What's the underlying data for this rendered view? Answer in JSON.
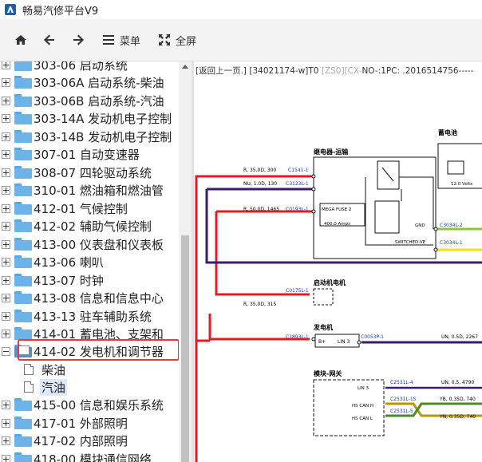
{
  "window": {
    "title": "畅易汽修平台V9"
  },
  "toolbar": {
    "menu_label": "菜单",
    "fullscreen_label": "全屏"
  },
  "tree": {
    "items": [
      {
        "label": "303-06 启动系统"
      },
      {
        "label": "303-06A 启动系统-柴油"
      },
      {
        "label": "303-06B 启动系统-汽油"
      },
      {
        "label": "303-14A 发动机电子控制"
      },
      {
        "label": "303-14B 发动机电子控制"
      },
      {
        "label": "307-01 自动变速器"
      },
      {
        "label": "308-07 四轮驱动系统"
      },
      {
        "label": "310-01 燃油箱和燃油管"
      },
      {
        "label": "412-01 气候控制"
      },
      {
        "label": "412-02 辅助气候控制"
      },
      {
        "label": "413-00 仪表盘和仪表板"
      },
      {
        "label": "413-06 喇叭"
      },
      {
        "label": "413-07 时钟"
      },
      {
        "label": "413-08 信息和信息中心"
      },
      {
        "label": "413-13 驻车辅助系统"
      },
      {
        "label": "414-01 蓄电池、支架和"
      },
      {
        "label": "414-02 发电机和调节器"
      },
      {
        "label": "415-00 信息和娱乐系统"
      },
      {
        "label": "417-01 外部照明"
      },
      {
        "label": "417-02 内部照明"
      },
      {
        "label": "418-00 模块通信网络"
      }
    ],
    "children": [
      {
        "label": "柴油"
      },
      {
        "label": "汽油"
      }
    ]
  },
  "diagram": {
    "header_main": "[返回上一页.]",
    "header_code": "[34021174-w]T0",
    "header_dim": "[ZS0][CX-",
    "header_tail": "NO-:1PC: .2016514756-----",
    "labels": {
      "battery": "蓄电池",
      "relay": "继电器-运输",
      "starter": "启动机电机",
      "generator": "发电机",
      "gateway": "模块-网关",
      "fuse": "MEGA FUSE 2",
      "fuse_amps": "400.0 Amps",
      "volts": "12.0 Volts",
      "gnd": "GND",
      "switched": "SWITCHED-VE",
      "lin3": "LIN 3",
      "lin3b": "LIN 3",
      "hs_can_h": "HS CAN H",
      "hs_can_l": "HS CAN L",
      "bplus": "B+"
    },
    "wires": {
      "w1": "R, 35.0D, 300",
      "w2": "NU, 1.0D, 130",
      "w3": "R, 50.0D, 1465",
      "w4": "R, 35.0D, 315",
      "w5": "UN, 0.5D, 2267",
      "w6": "UN, 0.5, 4790",
      "w7": "YB, 0.35D, 740",
      "w8": "YN, 0.35D, 740"
    },
    "connectors": {
      "c1": "C1541-1",
      "c2": "C3123L-1",
      "c3": "C0193L-1",
      "c4": "C3034L-2",
      "c5": "C3034L-1",
      "c6": "C0175L-1",
      "c7": "C1893L-1",
      "c8": "C0053P-1",
      "c9": "C2531L-4",
      "c10": "C2531L-15",
      "c11": "C2531L-5"
    }
  }
}
